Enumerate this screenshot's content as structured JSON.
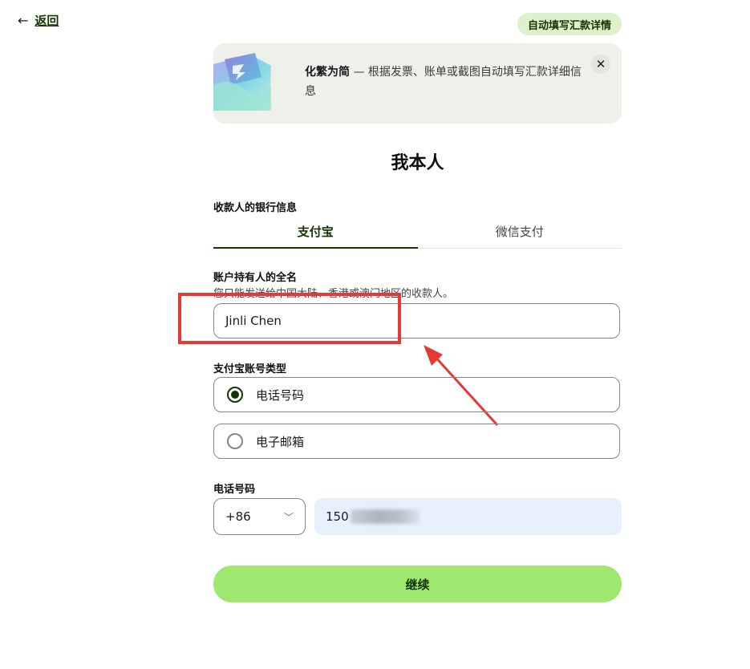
{
  "nav": {
    "back_label": "返回",
    "autofill_label": "自动填写汇款详情"
  },
  "banner": {
    "bold_text": "化繁为简",
    "text": " — 根据发票、账单或截图自动填写汇款详细信息",
    "close_icon": "close-icon"
  },
  "page": {
    "title": "我本人"
  },
  "bank_info": {
    "label": "收款人的银行信息",
    "tabs": [
      {
        "label": "支付宝",
        "active": true
      },
      {
        "label": "微信支付",
        "active": false
      }
    ]
  },
  "holder": {
    "label": "账户持有人的全名",
    "helper": "您只能发送给中国大陆、香港或澳门地区的收款人。",
    "value": "Jinli Chen"
  },
  "account_type": {
    "label": "支付宝账号类型",
    "options": [
      {
        "label": "电话号码",
        "selected": true
      },
      {
        "label": "电子邮箱",
        "selected": false
      }
    ]
  },
  "phone": {
    "label": "电话号码",
    "country_code": "+86",
    "value_visible": "150"
  },
  "actions": {
    "continue_label": "继续"
  },
  "colors": {
    "brand_green": "#9fe870",
    "dark_green": "#163300",
    "annotation_red": "#e53935",
    "autofill_bg": "#e8f0fe"
  }
}
